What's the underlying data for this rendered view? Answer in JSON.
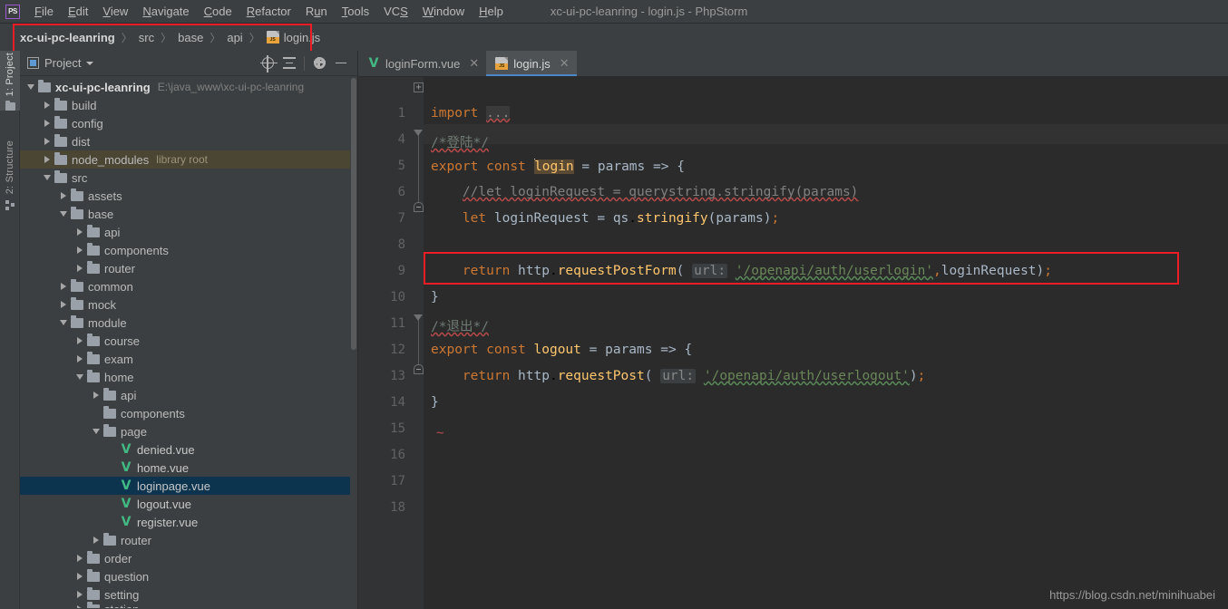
{
  "window": {
    "title": "xc-ui-pc-leanring - login.js - PhpStorm",
    "logo": "PS"
  },
  "menubar": {
    "items": [
      {
        "label": "File",
        "mnemonic": "F"
      },
      {
        "label": "Edit",
        "mnemonic": "E"
      },
      {
        "label": "View",
        "mnemonic": "V"
      },
      {
        "label": "Navigate",
        "mnemonic": "N"
      },
      {
        "label": "Code",
        "mnemonic": "C"
      },
      {
        "label": "Refactor",
        "mnemonic": "R"
      },
      {
        "label": "Run",
        "mnemonic": "u"
      },
      {
        "label": "Tools",
        "mnemonic": "T"
      },
      {
        "label": "VCS",
        "mnemonic": "S"
      },
      {
        "label": "Window",
        "mnemonic": "W"
      },
      {
        "label": "Help",
        "mnemonic": "H"
      }
    ]
  },
  "breadcrumb": {
    "items": [
      "xc-ui-pc-leanring",
      "src",
      "base",
      "api"
    ],
    "file": "login.js",
    "file_icon": "js-file-icon",
    "separator": "〉"
  },
  "left_tool_strip": {
    "tabs": [
      {
        "label": "1: Project",
        "icon": "folder-icon",
        "active": true
      },
      {
        "label": "2: Structure",
        "icon": "structure-icon",
        "active": false
      }
    ]
  },
  "project_panel": {
    "title": "Project",
    "title_icon": "project-view-icon",
    "dropdown_icon": "chevron-down-icon",
    "toolbar": [
      {
        "name": "scroll-from-source-button",
        "icon": "target-icon"
      },
      {
        "name": "collapse-all-button",
        "icon": "collapse-all-icon"
      },
      {
        "name": "settings-button",
        "icon": "gear-icon"
      },
      {
        "name": "hide-button",
        "icon": "minus-icon"
      }
    ],
    "tree": [
      {
        "label": "xc-ui-pc-leanring",
        "hint": "E:\\java_www\\xc-ui-pc-leanring",
        "depth": 0,
        "state": "open",
        "type": "folder",
        "bold": true
      },
      {
        "label": "build",
        "hint": "",
        "depth": 1,
        "state": "closed",
        "type": "folder"
      },
      {
        "label": "config",
        "hint": "",
        "depth": 1,
        "state": "closed",
        "type": "folder"
      },
      {
        "label": "dist",
        "hint": "",
        "depth": 1,
        "state": "closed",
        "type": "folder"
      },
      {
        "label": "node_modules",
        "hint": "library root",
        "depth": 1,
        "state": "closed",
        "type": "folder",
        "highlight": "library"
      },
      {
        "label": "src",
        "hint": "",
        "depth": 1,
        "state": "open",
        "type": "folder"
      },
      {
        "label": "assets",
        "hint": "",
        "depth": 2,
        "state": "closed",
        "type": "folder"
      },
      {
        "label": "base",
        "hint": "",
        "depth": 2,
        "state": "open",
        "type": "folder"
      },
      {
        "label": "api",
        "hint": "",
        "depth": 3,
        "state": "closed",
        "type": "folder"
      },
      {
        "label": "components",
        "hint": "",
        "depth": 3,
        "state": "closed",
        "type": "folder"
      },
      {
        "label": "router",
        "hint": "",
        "depth": 3,
        "state": "closed",
        "type": "folder"
      },
      {
        "label": "common",
        "hint": "",
        "depth": 2,
        "state": "closed",
        "type": "folder"
      },
      {
        "label": "mock",
        "hint": "",
        "depth": 2,
        "state": "closed",
        "type": "folder"
      },
      {
        "label": "module",
        "hint": "",
        "depth": 2,
        "state": "open",
        "type": "folder"
      },
      {
        "label": "course",
        "hint": "",
        "depth": 3,
        "state": "closed",
        "type": "folder"
      },
      {
        "label": "exam",
        "hint": "",
        "depth": 3,
        "state": "closed",
        "type": "folder"
      },
      {
        "label": "home",
        "hint": "",
        "depth": 3,
        "state": "open",
        "type": "folder"
      },
      {
        "label": "api",
        "hint": "",
        "depth": 4,
        "state": "closed",
        "type": "folder"
      },
      {
        "label": "components",
        "hint": "",
        "depth": 4,
        "state": "leaf",
        "type": "folder"
      },
      {
        "label": "page",
        "hint": "",
        "depth": 4,
        "state": "open",
        "type": "folder"
      },
      {
        "label": "denied.vue",
        "hint": "",
        "depth": 5,
        "state": "leaf",
        "type": "vue"
      },
      {
        "label": "home.vue",
        "hint": "",
        "depth": 5,
        "state": "leaf",
        "type": "vue"
      },
      {
        "label": "loginpage.vue",
        "hint": "",
        "depth": 5,
        "state": "leaf",
        "type": "vue",
        "highlight": "selected"
      },
      {
        "label": "logout.vue",
        "hint": "",
        "depth": 5,
        "state": "leaf",
        "type": "vue"
      },
      {
        "label": "register.vue",
        "hint": "",
        "depth": 5,
        "state": "leaf",
        "type": "vue"
      },
      {
        "label": "router",
        "hint": "",
        "depth": 4,
        "state": "closed",
        "type": "folder"
      },
      {
        "label": "order",
        "hint": "",
        "depth": 3,
        "state": "closed",
        "type": "folder"
      },
      {
        "label": "question",
        "hint": "",
        "depth": 3,
        "state": "closed",
        "type": "folder"
      },
      {
        "label": "setting",
        "hint": "",
        "depth": 3,
        "state": "closed",
        "type": "folder"
      },
      {
        "label": "station",
        "hint": "",
        "depth": 3,
        "state": "closed",
        "type": "folder",
        "clipped": true
      }
    ]
  },
  "editor": {
    "tabs": [
      {
        "label": "loginForm.vue",
        "icon": "vue-file-icon",
        "active": false,
        "close_icon": "close-icon"
      },
      {
        "label": "login.js",
        "icon": "js-file-icon",
        "active": true,
        "close_icon": "close-icon"
      }
    ],
    "line_numbers": [
      "1",
      "4",
      "5",
      "6",
      "7",
      "8",
      "9",
      "10",
      "11",
      "12",
      "13",
      "14",
      "15",
      "16",
      "17",
      "18"
    ],
    "code_lines": [
      {
        "num": "1",
        "text": "import ..."
      },
      {
        "num": "4",
        "text": "/*登陆*/"
      },
      {
        "num": "5",
        "text": "export const login = params => {"
      },
      {
        "num": "6",
        "text": "    //let loginRequest = querystring.stringify(params)"
      },
      {
        "num": "7",
        "text": "    let loginRequest = qs.stringify(params);"
      },
      {
        "num": "8",
        "text": ""
      },
      {
        "num": "9",
        "text": "    return http.requestPostForm( url: '/openapi/auth/userlogin',loginRequest);"
      },
      {
        "num": "10",
        "text": "}"
      },
      {
        "num": "11",
        "text": "/*退出*/"
      },
      {
        "num": "12",
        "text": "export const logout = params => {"
      },
      {
        "num": "13",
        "text": "    return http.requestPost( url: '/openapi/auth/userlogout');"
      },
      {
        "num": "14",
        "text": "}"
      },
      {
        "num": "15",
        "text": ""
      },
      {
        "num": "16",
        "text": ""
      },
      {
        "num": "17",
        "text": ""
      },
      {
        "num": "18",
        "text": ""
      }
    ],
    "tokens": {
      "import": "import",
      "ellipsis": "...",
      "comment_login": "/*登陆*/",
      "comment_logout": "/*退出*/",
      "export": "export",
      "const": "const",
      "let": "let",
      "return": "return",
      "login": "login",
      "logout": "logout",
      "params": "params",
      "arrow": "=>",
      "eq": "=",
      "open_brace": "{",
      "close_brace": "}",
      "commented_line": "//let loginRequest = querystring.stringify(params)",
      "qs": "qs",
      "stringify": "stringify",
      "loginRequest": "loginRequest",
      "http": "http",
      "requestPostForm": "requestPostForm",
      "requestPost": "requestPost",
      "url_hint": "url:",
      "login_url": "'/openapi/auth/userlogin'",
      "logout_url": "'/openapi/auth/userlogout'",
      "semicolon": ";",
      "comma": ",",
      "lparen": "(",
      "rparen": ")",
      "tilde": "~"
    }
  },
  "annotations": [
    {
      "name": "breadcrumb-highlight",
      "color": "#ee1c25"
    },
    {
      "name": "return-line-highlight",
      "color": "#ee1c25"
    }
  ],
  "watermark": "https://blog.csdn.net/minihuabei",
  "colors": {
    "background": "#3c3f41",
    "editor_background": "#2b2b2b",
    "gutter_background": "#313335",
    "selection": "#0d344f",
    "library_root": "#4b4534",
    "accent": "#4a88c7",
    "annotation_red": "#ee1c25",
    "keyword": "#cc7832",
    "string": "#6a8759",
    "function": "#ffc66d",
    "identifier": "#a9b7c6",
    "comment": "#808080",
    "vue_green": "#42b883"
  }
}
